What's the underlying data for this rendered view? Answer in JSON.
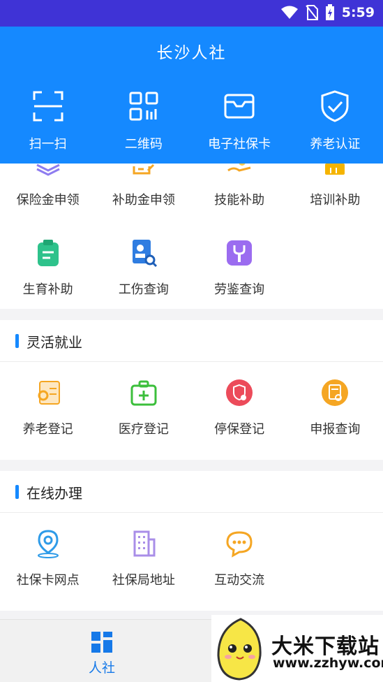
{
  "status": {
    "time": "5:59"
  },
  "header": {
    "title": "长沙人社",
    "quick": [
      {
        "label": "扫一扫",
        "icon": "scan-icon"
      },
      {
        "label": "二维码",
        "icon": "qrcode-icon"
      },
      {
        "label": "电子社保卡",
        "icon": "card-icon"
      },
      {
        "label": "养老认证",
        "icon": "shield-check-icon"
      }
    ]
  },
  "subsidy": {
    "row1": [
      {
        "label": "保险金申领",
        "icon": "layers-icon",
        "color": "#8e7cf0"
      },
      {
        "label": "补助金申领",
        "icon": "form-icon",
        "color": "#f5a623"
      },
      {
        "label": "技能补助",
        "icon": "hand-coin-icon",
        "color": "#f5a623"
      },
      {
        "label": "培训补助",
        "icon": "book-icon",
        "color": "#f5b400"
      }
    ],
    "row2": [
      {
        "label": "生育补助",
        "icon": "clipboard-icon",
        "color": "#2ec28b"
      },
      {
        "label": "工伤查询",
        "icon": "report-search-icon",
        "color": "#2f7de1"
      },
      {
        "label": "劳鉴查询",
        "icon": "wrench-icon",
        "color": "#9b6cf0"
      }
    ]
  },
  "flexible": {
    "title": "灵活就业",
    "items": [
      {
        "label": "养老登记",
        "icon": "elder-register-icon",
        "color": "#f5a623"
      },
      {
        "label": "医疗登记",
        "icon": "medical-kit-icon",
        "color": "#3cbf3c"
      },
      {
        "label": "停保登记",
        "icon": "stop-insurance-icon",
        "color": "#ec4b5a"
      },
      {
        "label": "申报查询",
        "icon": "declare-query-icon",
        "color": "#f5a623"
      }
    ]
  },
  "online": {
    "title": "在线办理",
    "items": [
      {
        "label": "社保卡网点",
        "icon": "location-icon",
        "color": "#2e9be8"
      },
      {
        "label": "社保局地址",
        "icon": "building-icon",
        "color": "#a98ee8"
      },
      {
        "label": "互动交流",
        "icon": "chat-icon",
        "color": "#f5a623"
      }
    ]
  },
  "tabbar": {
    "active_label": "人社",
    "active_icon": "grid-icon",
    "active_color": "#1679e8"
  },
  "watermark": {
    "text": "大米下载站",
    "url": "www.zzhyw.com"
  }
}
